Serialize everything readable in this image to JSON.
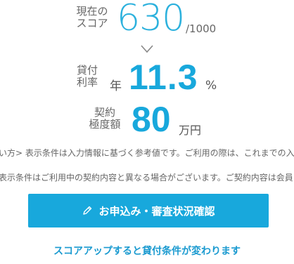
{
  "score": {
    "label": "現在の\nスコア",
    "value": "630",
    "max": "/1000"
  },
  "rate": {
    "label": "貸付\n利率",
    "prefix": "年",
    "value": "11.3",
    "unit": "%"
  },
  "limit": {
    "label": "契約\n極度額",
    "value": "80",
    "unit": "万円"
  },
  "notes": [
    "い方> 表示条件は入力情報に基づく参考値です。ご利用の際は、これまでの入",
    "表示条件はご利用中の契約内容と異なる場合がございます。ご契約内容は会員"
  ],
  "cta": {
    "label": "お申込み・審査状況確認",
    "icon": "pencil-icon"
  },
  "link": {
    "label": "スコアアップすると貸付条件が変わります"
  },
  "colors": {
    "accent": "#18a8dc",
    "text": "#555555"
  }
}
